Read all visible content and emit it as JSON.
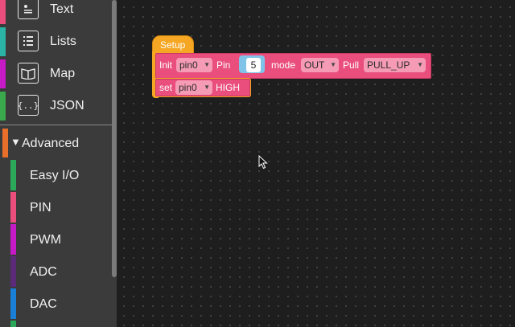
{
  "sidebar": {
    "categories": [
      {
        "label": "Text",
        "icon": "text-document-icon",
        "color": "#e94e7c"
      },
      {
        "label": "Lists",
        "icon": "list-icon",
        "color": "#2bb3a6"
      },
      {
        "label": "Map",
        "icon": "map-book-icon",
        "color": "#c71ac7"
      },
      {
        "label": "JSON",
        "icon": "json-braces-icon",
        "color": "#3aa84c"
      }
    ],
    "advanced": {
      "label": "Advanced",
      "toggle_glyph": "▼",
      "color": "#e8702a"
    },
    "sub_items": [
      {
        "label": "Easy I/O",
        "color": "#2ca85a"
      },
      {
        "label": "PIN",
        "color": "#e94e7c"
      },
      {
        "label": "PWM",
        "color": "#c71ac7"
      },
      {
        "label": "ADC",
        "color": "#5b2a78"
      },
      {
        "label": "DAC",
        "color": "#1a7fd6"
      }
    ]
  },
  "blocks": {
    "setup_label": "Setup",
    "init": {
      "init_label": "Init",
      "pin_dropdown": "pin0",
      "pin_label": "Pin",
      "pin_number": "5",
      "mode_label": "mode",
      "mode_dropdown": "OUT",
      "pull_label": "Pull",
      "pull_dropdown": "PULL_UP"
    },
    "set": {
      "set_label": "set",
      "pin_dropdown": "pin0",
      "value_label": "HIGH"
    },
    "dropdown_arrow": "▼"
  }
}
